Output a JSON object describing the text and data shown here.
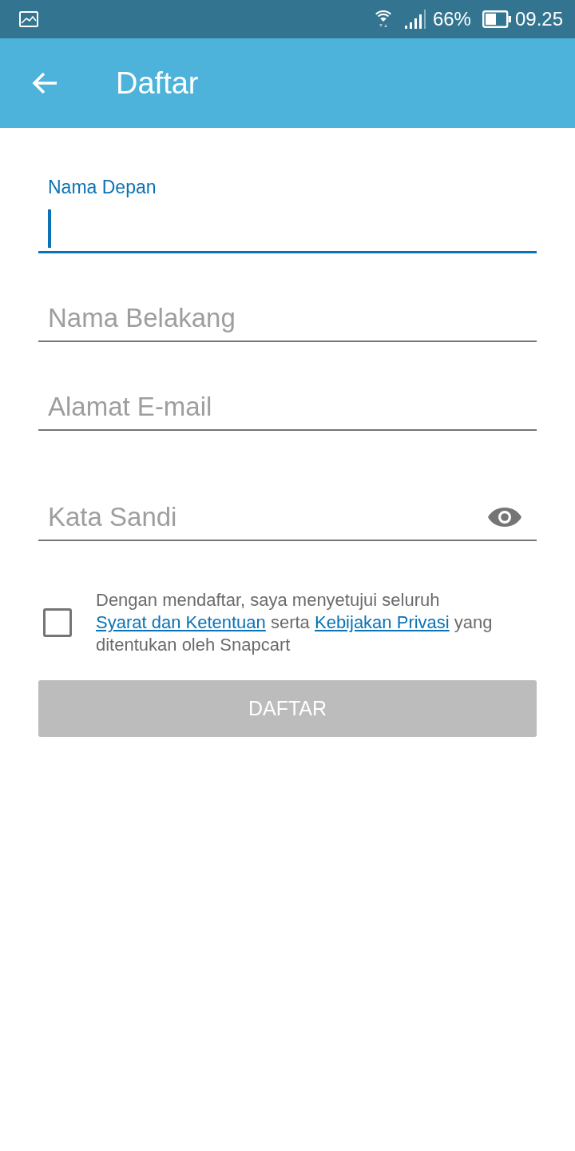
{
  "status_bar": {
    "battery": "66%",
    "time": "09.25"
  },
  "app_bar": {
    "title": "Daftar"
  },
  "fields": [
    {
      "kind": "text",
      "placeholder": "Nama Depan",
      "focused": true
    },
    {
      "kind": "text",
      "placeholder": "Nama Belakang",
      "focused": false
    },
    {
      "kind": "email",
      "placeholder": "Alamat E-mail",
      "focused": false
    },
    {
      "kind": "password",
      "placeholder": "Kata Sandi",
      "focused": false
    }
  ],
  "terms": {
    "checked": false,
    "segments": [
      {
        "kind": "text",
        "text": "Dengan mendaftar, saya menyetujui seluruh "
      },
      {
        "kind": "link",
        "text": "Syarat dan Ketentuan"
      },
      {
        "kind": "text",
        "text": " serta "
      },
      {
        "kind": "link",
        "text": "Kebijakan Privasi"
      },
      {
        "kind": "text",
        "text": " yang ditentukan oleh Snapcart"
      }
    ]
  },
  "submit": {
    "label": "DAFTAR",
    "disabled": true
  }
}
